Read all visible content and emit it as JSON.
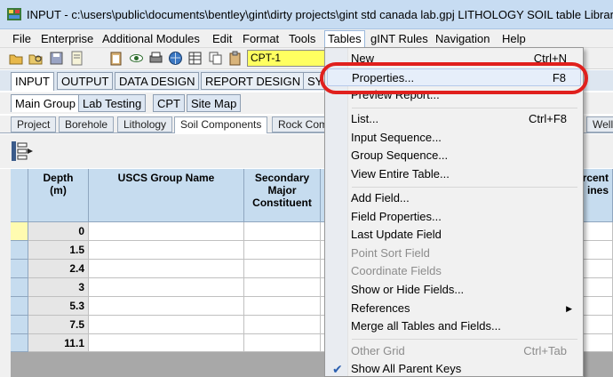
{
  "window": {
    "title": "INPUT - c:\\users\\public\\documents\\bentley\\gint\\dirty projects\\gint std canada lab.gpj   LITHOLOGY SOIL table   Library"
  },
  "menubar": [
    "File",
    "Enterprise",
    "Additional Modules",
    "Edit",
    "Format",
    "Tools",
    "Tables",
    "gINT Rules",
    "Navigation",
    "Help"
  ],
  "toolbar": {
    "project_combo": "CPT-1"
  },
  "main_tabs": [
    "INPUT",
    "OUTPUT",
    "DATA DESIGN",
    "REPORT DESIGN",
    "SY"
  ],
  "sub_tabs": [
    "Main Group",
    "Lab Testing",
    "CPT",
    "Site Map"
  ],
  "table_tabs": [
    "Project",
    "Borehole",
    "Lithology",
    "Soil Components",
    "Rock Com",
    "Well"
  ],
  "grid": {
    "headers": {
      "depth": "Depth\n(m)",
      "uscs": "USCS Group Name",
      "secondary": "Secondary\nMajor\nConstituent",
      "percent": "rcent\nines"
    },
    "depths": [
      "0",
      "1.5",
      "2.4",
      "3",
      "5.3",
      "7.5",
      "11.1"
    ]
  },
  "dropdown": {
    "items": [
      {
        "label": "New",
        "shortcut": "Ctrl+N",
        "disabled": false
      },
      {
        "label": "Properties...",
        "shortcut": "F8",
        "disabled": false
      },
      {
        "label": "Preview Report...",
        "shortcut": "",
        "disabled": false
      },
      {
        "label": "List...",
        "shortcut": "Ctrl+F8",
        "disabled": false
      },
      {
        "label": "Input Sequence...",
        "shortcut": "",
        "disabled": false
      },
      {
        "label": "Group Sequence...",
        "shortcut": "",
        "disabled": false
      },
      {
        "label": "View Entire Table...",
        "shortcut": "",
        "disabled": false
      },
      {
        "label": "Add Field...",
        "shortcut": "",
        "disabled": false
      },
      {
        "label": "Field Properties...",
        "shortcut": "",
        "disabled": false
      },
      {
        "label": "Last Update Field",
        "shortcut": "",
        "disabled": false
      },
      {
        "label": "Point Sort Field",
        "shortcut": "",
        "disabled": true
      },
      {
        "label": "Coordinate Fields",
        "shortcut": "",
        "disabled": true
      },
      {
        "label": "Show or Hide Fields...",
        "shortcut": "",
        "disabled": false
      },
      {
        "label": "References",
        "shortcut": "",
        "disabled": false
      },
      {
        "label": "Merge all Tables and Fields...",
        "shortcut": "",
        "disabled": false
      },
      {
        "label": "Other Grid",
        "shortcut": "Ctrl+Tab",
        "disabled": true
      },
      {
        "label": "Show All Parent Keys",
        "shortcut": "",
        "disabled": false
      }
    ]
  },
  "colors": {
    "highlight": "#e0201d",
    "combo_bg": "#ffff60",
    "header_bg": "#c6dcef"
  }
}
